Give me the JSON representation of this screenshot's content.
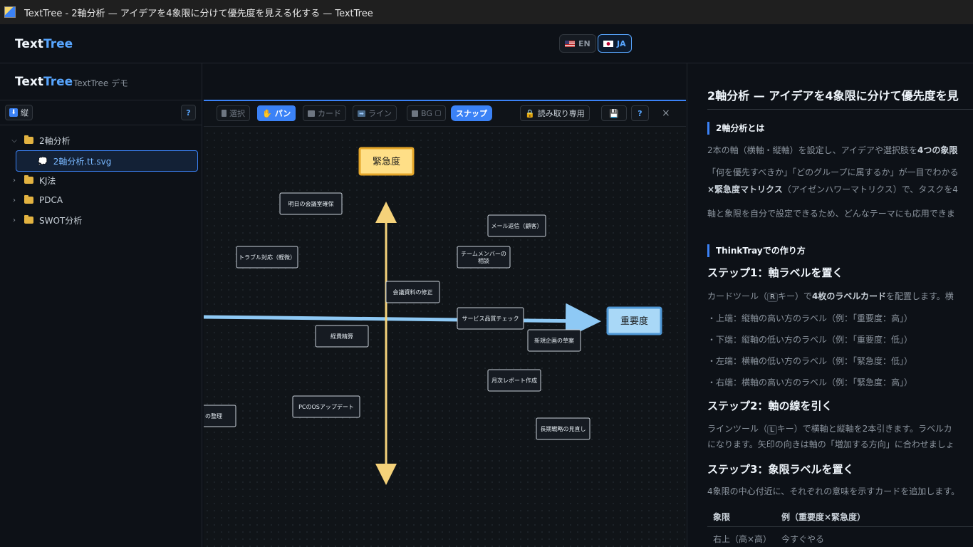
{
  "window": {
    "title": "TextTree - 2軸分析 — アイデアを4象限に分けて優先度を見える化する — TextTree"
  },
  "header": {
    "brand_a": "Text",
    "brand_b": "Tree",
    "langs": [
      {
        "label": "EN",
        "active": false
      },
      {
        "label": "JA",
        "active": true
      }
    ]
  },
  "sidebar": {
    "brand_a": "Text",
    "brand_b": "Tree",
    "subtitle": "TextTree デモ",
    "orient_label": "縦",
    "help_label": "?",
    "tree": [
      {
        "label": "2軸分析",
        "expanded": true
      },
      {
        "label": "2軸分析.tt.svg",
        "selected": true
      },
      {
        "label": "KJ法"
      },
      {
        "label": "PDCA"
      },
      {
        "label": "SWOT分析"
      }
    ]
  },
  "canvas_toolbar": {
    "select": "選択",
    "pan": "パン",
    "card": "カード",
    "line": "ライン",
    "bg": "BG",
    "snap": "スナップ",
    "readonly": "読み取り専用",
    "help": "?",
    "close": "×"
  },
  "canvas": {
    "axis_labels": {
      "vertical": "緊急度",
      "horizontal": "重要度"
    },
    "cards": [
      "明日の会議室確保",
      "メール返信（顧客）",
      "トラブル対応（軽微）",
      "チームメンバーの",
      "相談",
      "会議資料の修正",
      "サービス品質チェック",
      "経費精算",
      "新規企画の草案",
      "月次レポート作成",
      "PCのOSアップデート",
      "の整理",
      "長期戦略の見直し"
    ]
  },
  "doc": {
    "title": "2軸分析 — アイデアを4象限に分けて優先度を見",
    "section1": "2軸分析とは",
    "s1_p1a": "2本の軸（横軸・縦軸）を設定し、アイデアや選択肢を",
    "s1_p1b": "4つの象限",
    "s1_p2": "「何を優先すべきか」「どのグループに属するか」が一目でわかる",
    "s1_p3a": "×緊急度マトリクス",
    "s1_p3b": "（アイゼンハワーマトリクス）で、タスクを4",
    "s1_p4": "軸と象限を自分で設定できるため、どんなテーマにも応用できま",
    "section2": "ThinkTrayでの作り方",
    "step1": "ステップ1：軸ラベルを置く",
    "step1_p_a": "カードツール（",
    "step1_p_key": "R",
    "step1_p_b": "キー）で",
    "step1_p_c": "4枚のラベルカード",
    "step1_p_d": "を配置します。横",
    "bullets": [
      "・上端：縦軸の高い方のラベル（例：「重要度：高」）",
      "・下端：縦軸の低い方のラベル（例：「重要度：低」）",
      "・左端：横軸の低い方のラベル（例：「緊急度：低」）",
      "・右端：横軸の高い方のラベル（例：「緊急度：高」）"
    ],
    "step2": "ステップ2：軸の線を引く",
    "step2_p1a": "ラインツール（",
    "step2_p1key": "L",
    "step2_p1b": "キー）で横軸と縦軸を2本引きます。ラベルカ",
    "step2_p2": "になります。矢印の向きは軸の「増加する方向」に合わせましょ",
    "step3": "ステップ3：象限ラベルを置く",
    "step3_p": "4象限の中心付近に、それぞれの意味を示すカードを追加します。",
    "table": {
      "h1": "象限",
      "h2": "例（重要度×緊急度）",
      "rows": [
        {
          "c1": "右上（高×高）",
          "c2": "今すぐやる"
        }
      ]
    }
  }
}
